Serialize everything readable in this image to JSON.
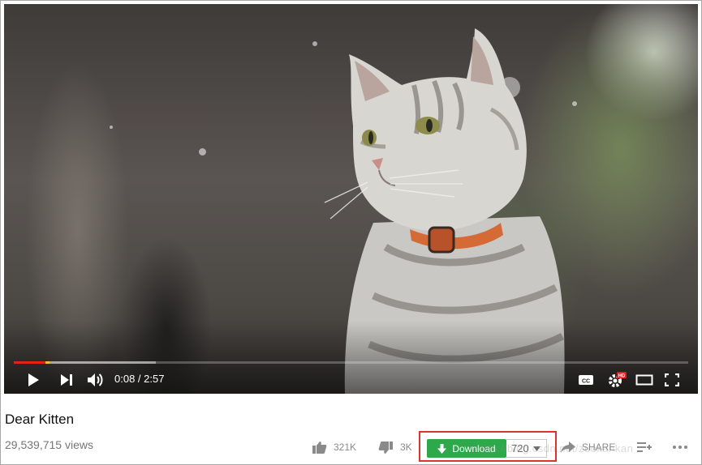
{
  "video": {
    "current_time": "0:08",
    "duration": "2:57",
    "time_display": "0:08 / 2:57",
    "progress_fraction": 0.047,
    "buffered_fraction": 0.21,
    "quality_badge": "HD"
  },
  "meta": {
    "title": "Dear Kitten",
    "views": "29,539,715 views"
  },
  "actions": {
    "likes": "321K",
    "dislikes": "3K",
    "share_label": "SHARE"
  },
  "download": {
    "label": "Download",
    "quality_value": "720"
  },
  "watermark": "http://blog.csdn.net/zuokankan",
  "colors": {
    "progress": "#e62117",
    "download_green": "#2da84a",
    "highlight_red": "#d9362c"
  },
  "icons": [
    "play-icon",
    "next-icon",
    "volume-icon",
    "captions-icon",
    "settings-icon",
    "theater-icon",
    "fullscreen-icon",
    "thumbs-up-icon",
    "thumbs-down-icon",
    "download-arrow-icon",
    "chevron-down-icon",
    "share-icon",
    "add-to-playlist-icon",
    "more-icon"
  ]
}
